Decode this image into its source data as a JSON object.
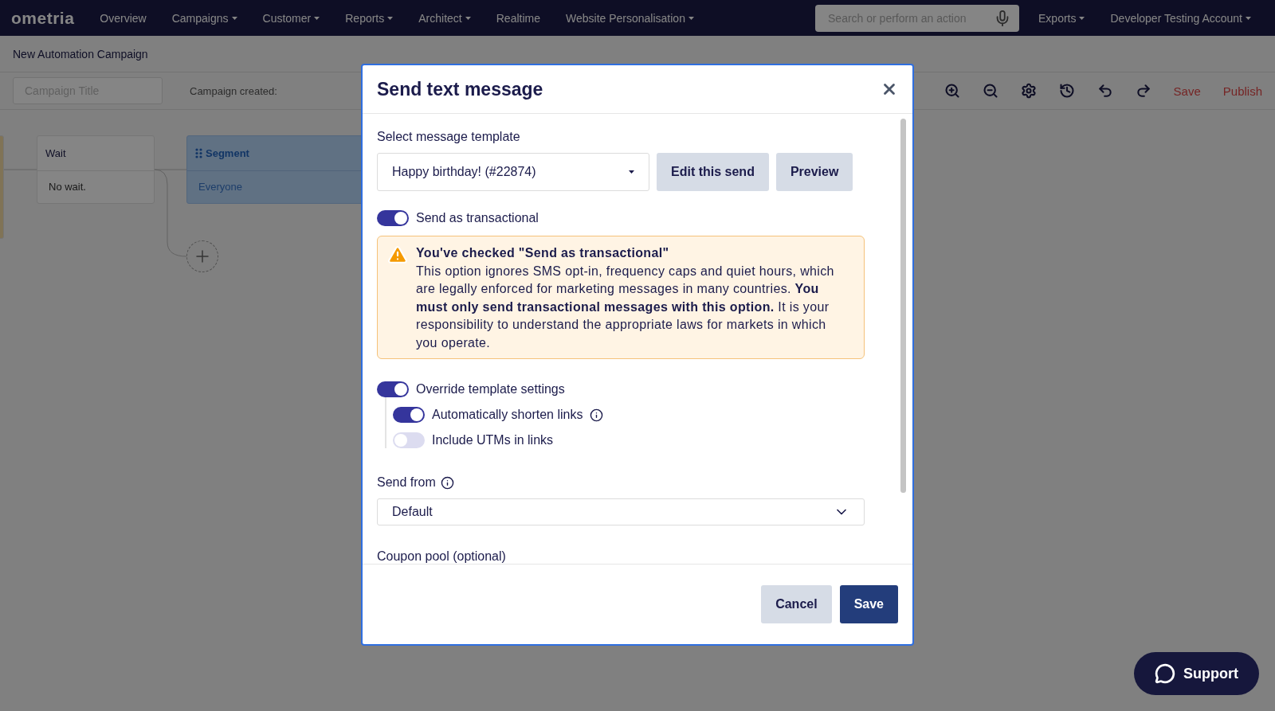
{
  "nav": {
    "logo": "ometria",
    "items": [
      {
        "label": "Overview",
        "dropdown": false
      },
      {
        "label": "Campaigns",
        "dropdown": true
      },
      {
        "label": "Customer",
        "dropdown": true
      },
      {
        "label": "Reports",
        "dropdown": true
      },
      {
        "label": "Architect",
        "dropdown": true
      },
      {
        "label": "Realtime",
        "dropdown": false
      },
      {
        "label": "Website Personalisation",
        "dropdown": true
      }
    ],
    "search": {
      "placeholder": "Search or perform an action"
    },
    "right_items": [
      {
        "label": "Exports",
        "dropdown": true
      },
      {
        "label": "Developer Testing Account",
        "dropdown": true
      }
    ]
  },
  "page_title": "New Automation Campaign",
  "toolbar": {
    "campaign_title": {
      "placeholder": "Campaign Title"
    },
    "created_label": "Campaign created:",
    "actions": [
      "Save",
      "Publish"
    ]
  },
  "canvas": {
    "nodes": [
      {
        "kind": "edge"
      },
      {
        "kind": "wait",
        "title": "Wait",
        "body": "No wait."
      },
      {
        "kind": "segment",
        "title": "Segment",
        "body": "Everyone"
      }
    ]
  },
  "modal": {
    "title": "Send text message",
    "template_label": "Select message template",
    "template_value": "Happy birthday! (#22874)",
    "template_buttons": [
      "Edit this send",
      "Preview"
    ],
    "toggles": [
      {
        "label": "Send as transactional",
        "on": true,
        "info": false
      },
      {
        "label": "Override template settings",
        "on": true,
        "info": false,
        "children": [
          {
            "label": "Automatically shorten links",
            "on": true,
            "info": true
          },
          {
            "label": "Include UTMs in links",
            "on": false,
            "info": false
          }
        ]
      }
    ],
    "warning": {
      "title": "You've checked \"Send as transactional\"",
      "body": "This option ignores SMS opt-in, frequency caps and quiet hours, which are legally enforced for marketing messages in many countries. **You must only send transactional messages with this option.** It is your responsibility to understand the appropriate laws for markets in which you operate."
    },
    "send_from_label": "Send from",
    "send_from_value": "Default",
    "coupon_label": "Coupon pool (optional)",
    "footer_buttons": [
      {
        "label": "Cancel",
        "kind": "secondary"
      },
      {
        "label": "Save",
        "kind": "primary"
      }
    ]
  },
  "support": "Support"
}
